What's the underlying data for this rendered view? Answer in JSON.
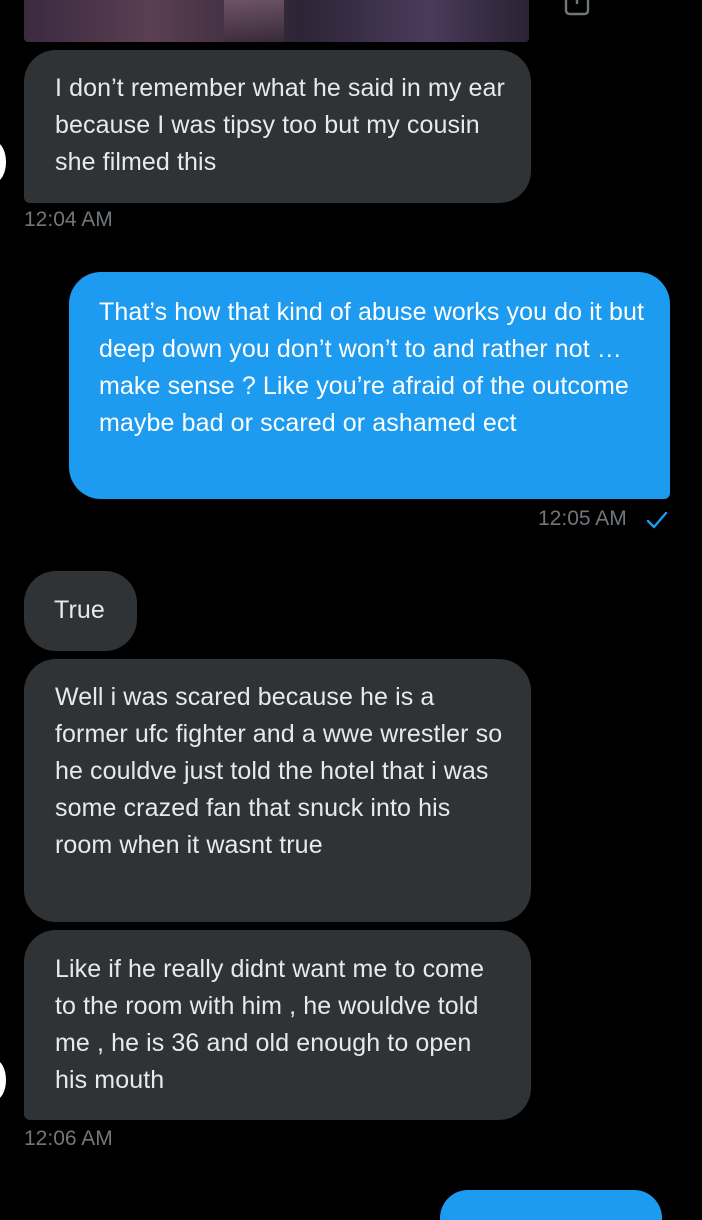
{
  "messages": [
    {
      "text": "I don’t remember what he said in my ear because I was tipsy too but my cousin she filmed this"
    },
    {
      "text": "That’s how that kind of abuse works you do it but deep down you don’t won’t to and rather not … make sense ? Like you’re afraid of the outcome maybe bad or scared or ashamed ect"
    },
    {
      "text": "True"
    },
    {
      "text": "Well i was scared because he is a former ufc fighter and a wwe wrestler so he couldve just told the hotel that i was some crazed fan that snuck into his room when it wasnt true"
    },
    {
      "text": "Like if he really didnt want me to come to the room with him , he wouldve told me , he is 36 and old enough to open his mouth"
    }
  ],
  "timestamps": {
    "first": "12:04 AM",
    "second": "12:05 AM",
    "third": "12:06 AM"
  },
  "colors": {
    "background": "#000000",
    "incoming_bubble": "#2f3336",
    "outgoing_bubble": "#1d9bf0",
    "timestamp": "#71767b",
    "read_check": "#1d9bf0"
  },
  "icons": {
    "share": "share-icon",
    "read_receipt": "checkmark-icon"
  }
}
